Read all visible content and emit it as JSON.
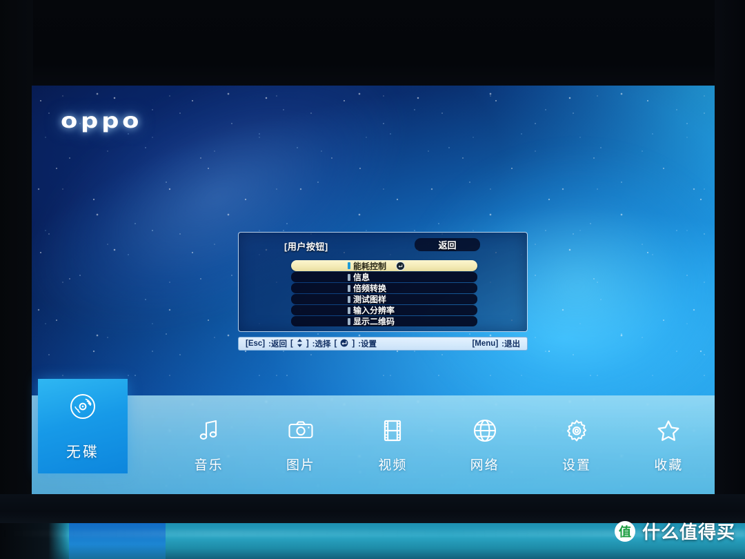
{
  "brand": {
    "logo_text": "oppo"
  },
  "osd": {
    "title": "[用户按钮]",
    "back_button": "返回",
    "items": [
      {
        "label": "能耗控制",
        "selected": true,
        "has_enter_icon": true
      },
      {
        "label": "信息",
        "selected": false,
        "has_enter_icon": false
      },
      {
        "label": "倍频转换",
        "selected": false,
        "has_enter_icon": false
      },
      {
        "label": "测试图样",
        "selected": false,
        "has_enter_icon": false
      },
      {
        "label": "输入分辨率",
        "selected": false,
        "has_enter_icon": false
      },
      {
        "label": "显示二维码",
        "selected": false,
        "has_enter_icon": false
      }
    ],
    "footer": {
      "esc_key": "[Esc]",
      "esc_action": ":返回",
      "updown_key_pre": "[",
      "updown_key_post": "]",
      "updown_action": ":选择",
      "enter_key_pre": "[",
      "enter_key_post": "]",
      "enter_action": ":设置",
      "menu_key": "[Menu]",
      "menu_action": ":退出"
    },
    "colors": {
      "highlight": "#f4ebb7",
      "panel_border": "#d7ebff",
      "footer_text": "#123063"
    }
  },
  "source_tile": {
    "label": "无碟",
    "icon": "disc-icon",
    "active": true,
    "color": "#179ae8"
  },
  "nav": {
    "items": [
      {
        "label": "音乐",
        "icon": "music-note-icon"
      },
      {
        "label": "图片",
        "icon": "camera-icon"
      },
      {
        "label": "视频",
        "icon": "film-strip-icon"
      },
      {
        "label": "网络",
        "icon": "globe-icon"
      },
      {
        "label": "设置",
        "icon": "gear-icon"
      },
      {
        "label": "收藏",
        "icon": "star-icon"
      }
    ]
  },
  "watermark": {
    "badge": "值",
    "text": "什么值得买"
  }
}
